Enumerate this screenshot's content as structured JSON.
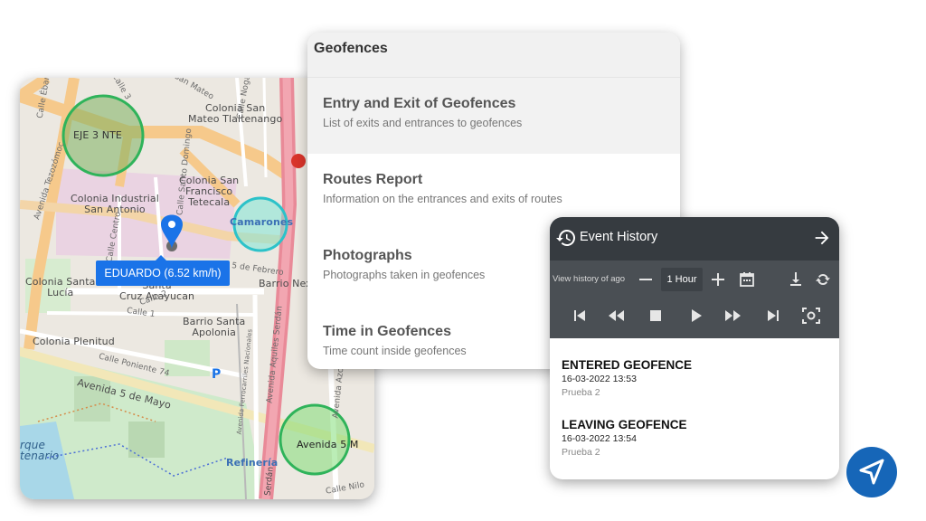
{
  "map": {
    "vehicle_label": "EDUARDO (6.52 km/h)",
    "labels": {
      "eje3": "EJE 3 NTE",
      "colonia_san_mateo": "Colonia San\nMateo Tlaltenango",
      "san_mateo": "San Mateo",
      "colonia_industrial": "Colonia Industrial\nSan Antonio",
      "colonia_san_francisco": "Colonia San\nFrancisco\nTetecala",
      "camarones": "Camarones",
      "colonia_santa_lucia": "Colonia Santa\nLucía",
      "santa_cruz": "Santa\nCruz Acayucan",
      "barrio_nextengo": "Barrio Nex",
      "barrio_santa_apolonia": "Barrio Santa\nApolonia",
      "colonia_plenitud": "Colonia Plenitud",
      "calle_poniente": "Calle Poniente 74",
      "avenida_5_mayo": "Avenida 5 de Mayo",
      "avenida_5_ma": "Avenida 5 M",
      "refineria": "Refinería",
      "parque": "rque\ntenario",
      "avenida_aquiles": "Avenida Aquiles Serdán",
      "avenida_tezozomoc": "Avenida Tezozómoc",
      "febrero": "5 de Febrero",
      "calle_1": "Calle 1",
      "calle_2": "Calle 2",
      "calle_3": "Calle 3",
      "calle_nogales": "Calle Nogal",
      "calle_ebano": "Calle Ébano",
      "calle_centro": "Calle Centro",
      "calle_santo_domingo": "Calle Santo Domingo",
      "serdan": "Serdán",
      "calle_nilo": "Calle Nilo",
      "avenida_azca": "Avenida Azca",
      "calle_ferro": "Avenida Ferrocarriles Nacionales",
      "parking": "P"
    }
  },
  "geofences": {
    "title": "Geofences",
    "items": [
      {
        "title": "Entry and Exit of Geofences",
        "desc": "List of exits and entrances to geofences"
      },
      {
        "title": "Routes Report",
        "desc": "Information on the entrances and exits of routes"
      },
      {
        "title": "Photographs",
        "desc": "Photographs taken in geofences"
      },
      {
        "title": "Time in Geofences",
        "desc": "Time count inside geofences"
      }
    ]
  },
  "event_history": {
    "title": "Event History",
    "view_label": "View history of ago",
    "duration": "1 Hour",
    "events": [
      {
        "title": "ENTERED GEOFENCE",
        "time": "16-03-2022 13:53",
        "sub": "Prueba 2"
      },
      {
        "title": "LEAVING GEOFENCE",
        "time": "16-03-2022 13:54",
        "sub": "Prueba 2"
      }
    ]
  },
  "icons": {
    "history": "history-icon",
    "arrow": "arrow-right-icon",
    "minus": "minus-icon",
    "plus": "plus-icon",
    "calendar": "calendar-icon",
    "download": "download-icon",
    "sync": "sync-icon",
    "skip_start": "skip-start-icon",
    "rewind": "rewind-icon",
    "stop": "stop-icon",
    "play": "play-icon",
    "fast_forward": "fast-forward-icon",
    "skip_end": "skip-end-icon",
    "focus": "focus-icon",
    "navigation": "navigation-icon"
  },
  "colors": {
    "primary_blue": "#1a73e8",
    "nav_blue": "#1666b8",
    "panel_dark": "#363b40",
    "controls_dark": "#4a4f54",
    "geofence_green": "#2fb35a",
    "geofence_cyan": "#2cc2c9"
  }
}
